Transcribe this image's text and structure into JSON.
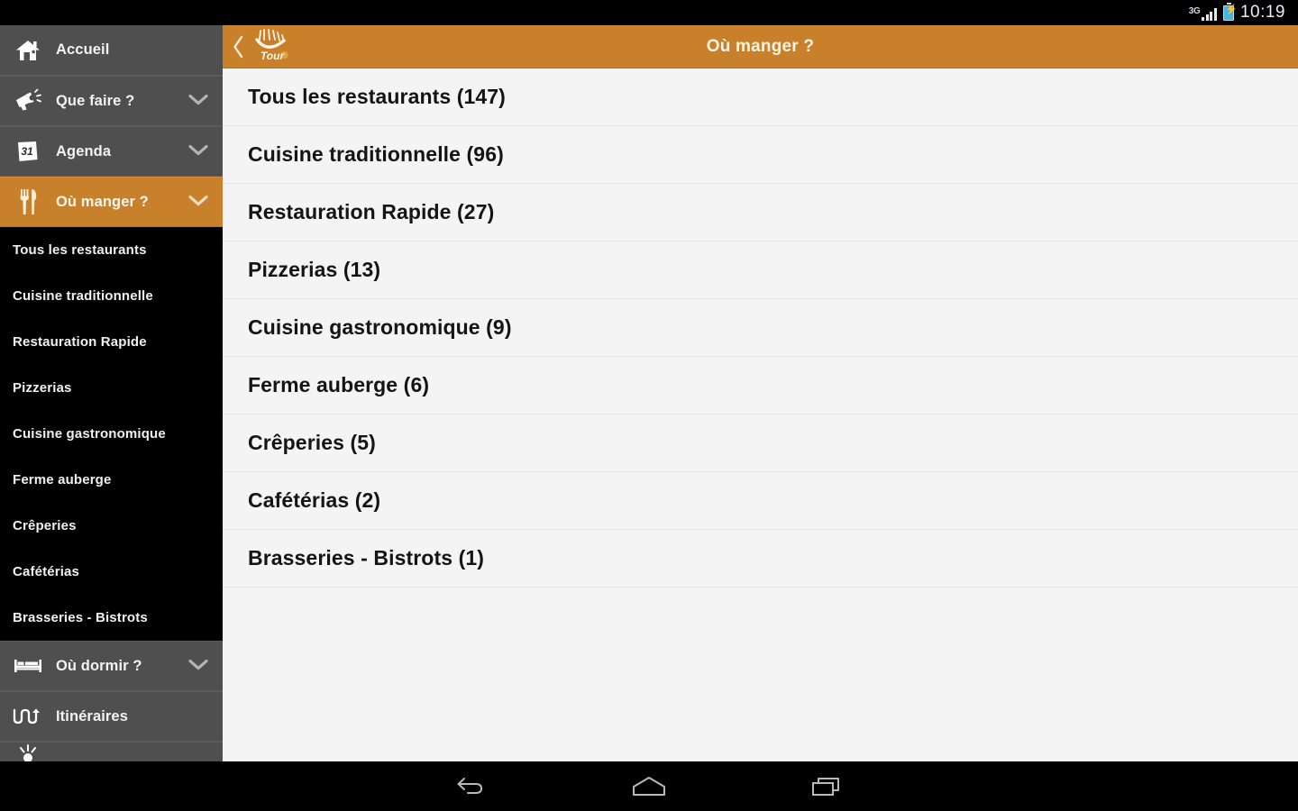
{
  "status_bar": {
    "network": "3G",
    "clock": "10:19",
    "battery_icon": "battery-charging-icon",
    "signal_icon": "signal-bars-icon"
  },
  "app_bar": {
    "back_icon": "back-chevron-icon",
    "logo_text": "Tour",
    "logo_icon": "smile-logo-icon",
    "title": "Où manger ?",
    "accent_color": "#c8802a"
  },
  "sidebar": {
    "background_color": "#4f4f4f",
    "submenu_background_color": "#000000",
    "items": [
      {
        "label": "Accueil",
        "icon": "home-icon",
        "expandable": false,
        "active": false
      },
      {
        "label": "Que faire ?",
        "icon": "megaphone-icon",
        "expandable": true,
        "active": false
      },
      {
        "label": "Agenda",
        "icon": "calendar-31-icon",
        "expandable": true,
        "active": false
      },
      {
        "label": "Où manger ?",
        "icon": "cutlery-icon",
        "expandable": true,
        "active": true
      },
      {
        "label": "Où dormir ?",
        "icon": "bed-icon",
        "expandable": true,
        "active": false
      },
      {
        "label": "Itinéraires",
        "icon": "winding-road-icon",
        "expandable": false,
        "active": false
      }
    ],
    "submenu": [
      {
        "label": "Tous les restaurants"
      },
      {
        "label": "Cuisine traditionnelle"
      },
      {
        "label": "Restauration Rapide"
      },
      {
        "label": "Pizzerias"
      },
      {
        "label": "Cuisine gastronomique"
      },
      {
        "label": "Ferme auberge"
      },
      {
        "label": "Crêperies"
      },
      {
        "label": "Cafétérias"
      },
      {
        "label": "Brasseries - Bistrots"
      }
    ],
    "clipped_item": {
      "icon": "sun-icon"
    }
  },
  "main_list": {
    "items": [
      {
        "label": "Tous les restaurants (147)",
        "name": "Tous les restaurants",
        "count": 147
      },
      {
        "label": "Cuisine traditionnelle (96)",
        "name": "Cuisine traditionnelle",
        "count": 96
      },
      {
        "label": "Restauration Rapide (27)",
        "name": "Restauration Rapide",
        "count": 27
      },
      {
        "label": "Pizzerias (13)",
        "name": "Pizzerias",
        "count": 13
      },
      {
        "label": "Cuisine gastronomique (9)",
        "name": "Cuisine gastronomique",
        "count": 9
      },
      {
        "label": "Ferme auberge (6)",
        "name": "Ferme auberge",
        "count": 6
      },
      {
        "label": "Crêperies (5)",
        "name": "Crêperies",
        "count": 5
      },
      {
        "label": "Cafétérias (2)",
        "name": "Cafétérias",
        "count": 2
      },
      {
        "label": "Brasseries - Bistrots (1)",
        "name": "Brasseries - Bistrots",
        "count": 1
      }
    ]
  },
  "nav_bar": {
    "buttons": [
      {
        "icon": "back-arrow-icon"
      },
      {
        "icon": "home-pentagon-icon"
      },
      {
        "icon": "recents-icon"
      }
    ]
  }
}
